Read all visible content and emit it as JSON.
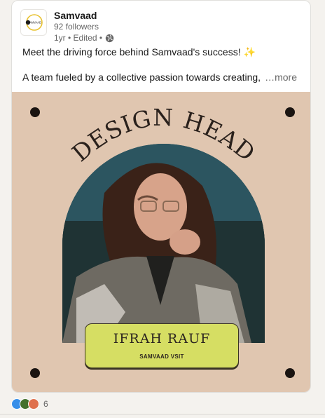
{
  "post": {
    "author": "Samvaad",
    "followers": "92 followers",
    "meta": "1yr • Edited •",
    "logo_text": "SAMVAAD",
    "text_line1": "Meet the driving force behind Samvaad's success! ✨",
    "text_line2": "A team fueled by a collective passion towards creating,",
    "more_label": "…more"
  },
  "image": {
    "heading": "DESIGN HEAD",
    "name": "IFRAH RAUF",
    "subtitle": "SAMVAAD VSIT",
    "bg_color": "#e0c6b0",
    "box_color": "#d6de63"
  },
  "social": {
    "reaction_count": "6",
    "reaction_icons": [
      "like-icon",
      "celebrate-icon",
      "love-icon"
    ]
  }
}
